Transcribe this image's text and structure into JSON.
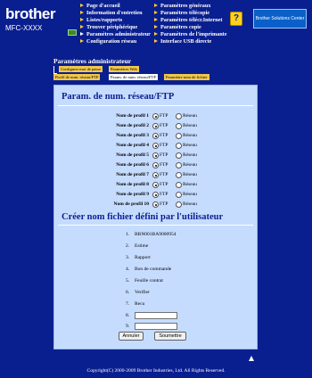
{
  "header": {
    "brand": "brother",
    "model": "MFC-XXXX",
    "nav_left": [
      {
        "label": "Page d'accueil",
        "selected": false
      },
      {
        "label": "Information d'entretien",
        "selected": false
      },
      {
        "label": "Listes/rapports",
        "selected": false
      },
      {
        "label": "Trouver périphérique",
        "selected": false
      },
      {
        "label": "Paramètres administrateur",
        "selected": true
      },
      {
        "label": "Configuration réseau",
        "selected": false
      }
    ],
    "nav_right": [
      {
        "label": "Paramètres généraux"
      },
      {
        "label": "Paramètres télécopie"
      },
      {
        "label": "Paramètres télécr.Internet"
      },
      {
        "label": "Paramètres copie"
      },
      {
        "label": "Paramètres de l'imprimante"
      },
      {
        "label": "Interface USB directe"
      }
    ],
    "bsc_button": "Brother Solutions Center"
  },
  "section_title": "Paramètres administrateur",
  "tabs": [
    {
      "label": "Configurer mot de passe",
      "active": false
    },
    {
      "label": "Paramètres Web",
      "active": false
    },
    {
      "label": "Profil de num. réseau/FTP",
      "active": false
    },
    {
      "label": "Param. de num. réseau/FTP",
      "active": true
    },
    {
      "label": "Paramètre nom de fichier",
      "active": false
    }
  ],
  "ftp_section": {
    "heading": "Param. de num. réseau/FTP",
    "ftp_label": "FTP",
    "reseau_label": "Réseau",
    "profiles": [
      {
        "label": "Nom de profil 1",
        "selected": "FTP"
      },
      {
        "label": "Nom de profil 2",
        "selected": "FTP"
      },
      {
        "label": "Nom de profil 3",
        "selected": "FTP"
      },
      {
        "label": "Nom de profil 4",
        "selected": "FTP"
      },
      {
        "label": "Nom de profil 5",
        "selected": "FTP"
      },
      {
        "label": "Nom de profil 6",
        "selected": "FTP"
      },
      {
        "label": "Nom de profil 7",
        "selected": "FTP"
      },
      {
        "label": "Nom de profil 8",
        "selected": "FTP"
      },
      {
        "label": "Nom de profil 9",
        "selected": "FTP"
      },
      {
        "label": "Nom de profil 10",
        "selected": "FTP"
      }
    ]
  },
  "filename_section": {
    "heading": "Créer nom fichier défini par l'utilisateur",
    "items": [
      {
        "num": "1.",
        "value": "BRN001BA9000954"
      },
      {
        "num": "2.",
        "value": "Estime"
      },
      {
        "num": "3.",
        "value": "Rapport"
      },
      {
        "num": "4.",
        "value": "Bon de commande"
      },
      {
        "num": "5.",
        "value": "Feuille contrat"
      },
      {
        "num": "6.",
        "value": "Verifier"
      },
      {
        "num": "7.",
        "value": "Recu"
      }
    ],
    "inputs": [
      {
        "num": "8.",
        "value": ""
      },
      {
        "num": "9.",
        "value": ""
      }
    ]
  },
  "buttons": {
    "cancel": "Annuler",
    "submit": "Soumettre"
  },
  "footer": {
    "copyright": "Copyright(C) 2000-2009 Brother Industries, Ltd. All Rights Reserved."
  }
}
